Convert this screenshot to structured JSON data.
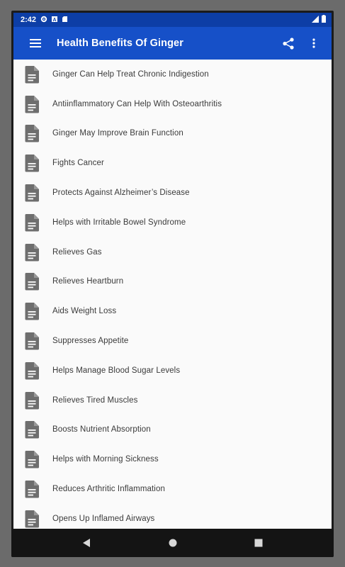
{
  "status": {
    "time": "2:42",
    "icons": [
      "settings-icon",
      "notification-icon",
      "sd-card-icon"
    ],
    "right_icons": [
      "signal-icon",
      "battery-icon"
    ]
  },
  "app_bar": {
    "title": "Health Benefits Of Ginger",
    "actions": [
      "share-icon",
      "more-vert-icon"
    ],
    "color": "#1650c8"
  },
  "list": {
    "items": [
      "Ginger Can Help Treat Chronic Indigestion",
      "Antiinflammatory Can Help With Osteoarthritis",
      "Ginger May Improve Brain Function",
      "Fights Cancer",
      "Protects Against Alzheimer’s Disease",
      "Helps with Irritable Bowel Syndrome",
      "Relieves Gas",
      "Relieves Heartburn",
      "Aids Weight Loss",
      "Suppresses Appetite",
      "Helps Manage Blood Sugar Levels",
      "Relieves Tired Muscles",
      "Boosts Nutrient Absorption",
      "Helps with Morning Sickness",
      "Reduces Arthritic Inflammation",
      "Opens Up Inflamed Airways"
    ],
    "icon": "document-icon"
  },
  "nav": {
    "buttons": [
      "back-icon",
      "home-icon",
      "recents-icon"
    ]
  }
}
